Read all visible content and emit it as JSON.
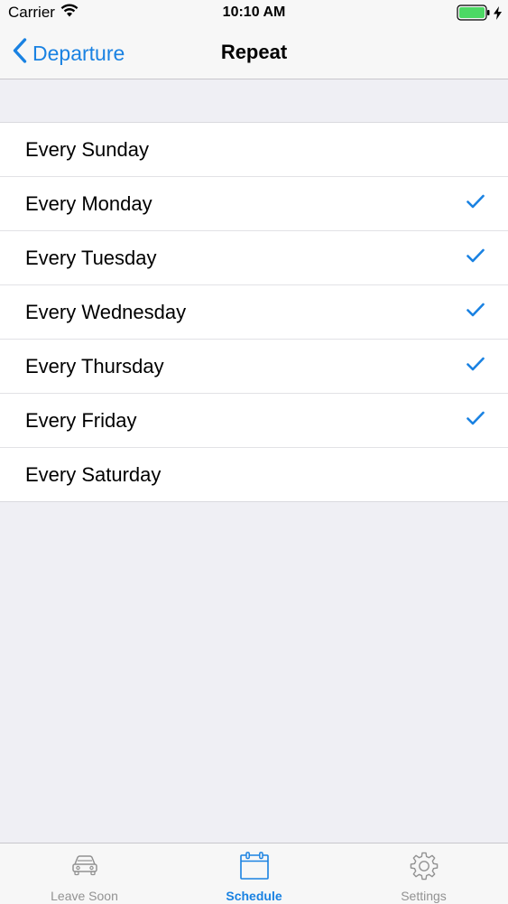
{
  "status_bar": {
    "carrier": "Carrier",
    "time": "10:10 AM",
    "wifi_icon": "wifi-icon",
    "battery_icon": "battery-icon",
    "charging_icon": "charging-bolt-icon",
    "battery_color": "#4CD964"
  },
  "nav": {
    "back_label": "Departure",
    "back_icon": "chevron-left-icon",
    "title": "Repeat",
    "accent_color": "#1A82E2"
  },
  "days": [
    {
      "label": "Every Sunday",
      "checked": false
    },
    {
      "label": "Every Monday",
      "checked": true
    },
    {
      "label": "Every Tuesday",
      "checked": true
    },
    {
      "label": "Every Wednesday",
      "checked": true
    },
    {
      "label": "Every Thursday",
      "checked": true
    },
    {
      "label": "Every Friday",
      "checked": true
    },
    {
      "label": "Every Saturday",
      "checked": false
    }
  ],
  "tabs": [
    {
      "label": "Leave Soon",
      "icon": "car-icon",
      "active": false
    },
    {
      "label": "Schedule",
      "icon": "calendar-icon",
      "active": true
    },
    {
      "label": "Settings",
      "icon": "gear-icon",
      "active": false
    }
  ]
}
